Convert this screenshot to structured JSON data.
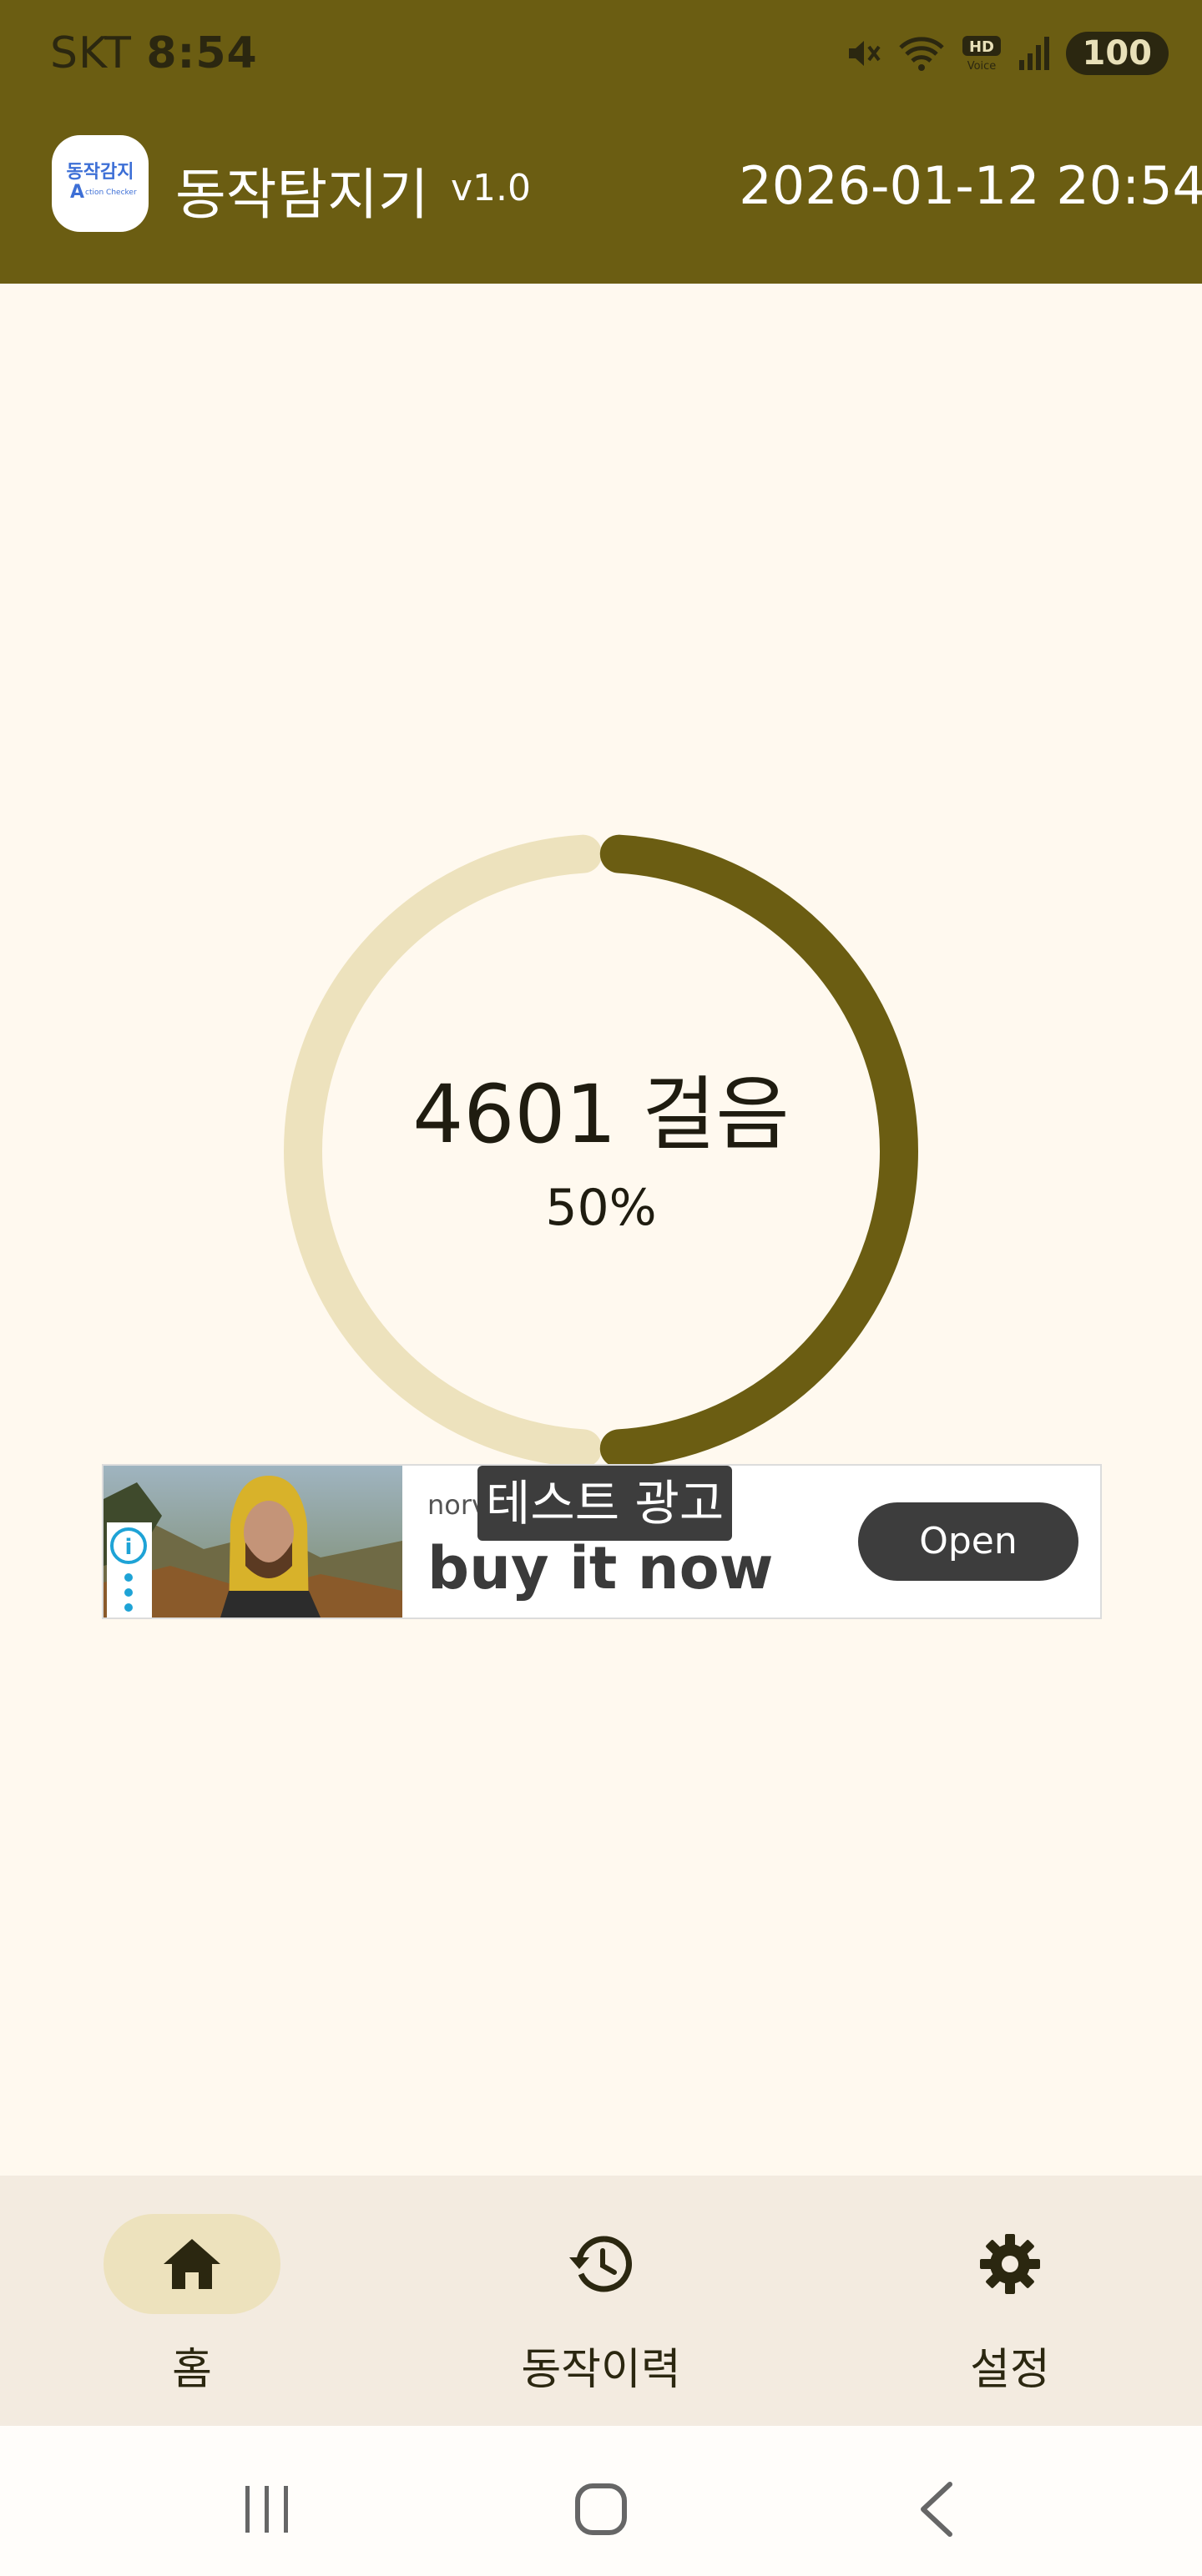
{
  "status_bar": {
    "carrier": "SKT",
    "time": "8:54",
    "battery": "100",
    "icons": [
      "mute-icon",
      "wifi-icon",
      "hd-voice-icon",
      "signal-icon"
    ]
  },
  "header": {
    "logo_line1": "동작감지",
    "logo_line2": "A",
    "logo_line3": "ction Checker",
    "title": "동작탐지기",
    "version": "v1.0",
    "datetime": "2026-01-12 20:54"
  },
  "progress": {
    "steps_label": "4601 걸음",
    "percent_label": "50%",
    "fraction": 0.5,
    "colors": {
      "filled": "#6b5d12",
      "track": "#ede2bd"
    }
  },
  "ad": {
    "advertiser": "norv",
    "headline": "buy it now",
    "test_label": "테스트 광고",
    "cta": "Open"
  },
  "bottom_nav": {
    "items": [
      {
        "label": "홈",
        "icon": "home-icon",
        "active": true
      },
      {
        "label": "동작이력",
        "icon": "history-icon",
        "active": false
      },
      {
        "label": "설정",
        "icon": "gear-icon",
        "active": false
      }
    ]
  },
  "system_nav": {
    "icons": [
      "recent-apps-icon",
      "home-circle-icon",
      "back-icon"
    ]
  }
}
